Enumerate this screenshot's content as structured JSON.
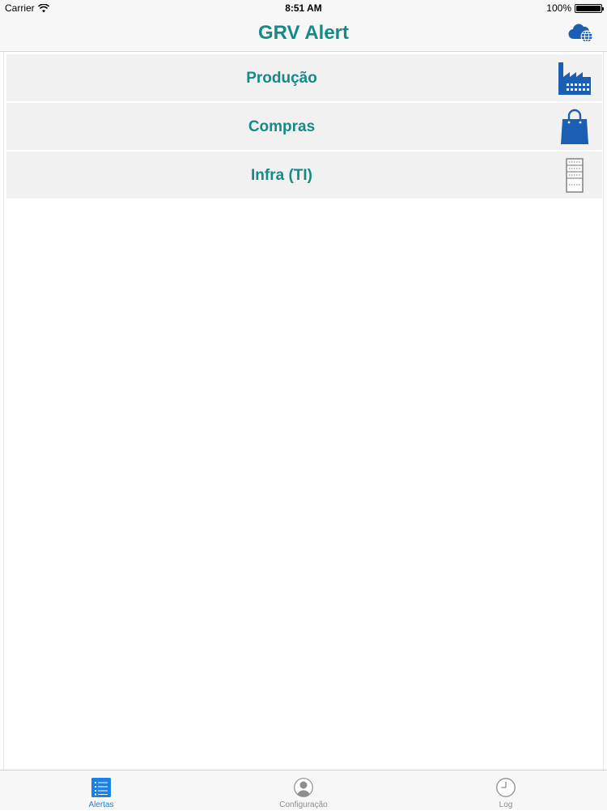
{
  "status_bar": {
    "carrier": "Carrier",
    "time": "8:51 AM",
    "battery": "100%",
    "battery_level": 1.0
  },
  "nav": {
    "title": "GRV Alert",
    "right_icon": "cloud-globe-icon"
  },
  "menu": {
    "items": [
      {
        "label": "Produção",
        "icon": "factory-icon"
      },
      {
        "label": "Compras",
        "icon": "shopping-bag-icon"
      },
      {
        "label": "Infra (TI)",
        "icon": "server-icon"
      }
    ]
  },
  "tabs": {
    "items": [
      {
        "label": "Alertas",
        "icon": "list-icon",
        "active": true
      },
      {
        "label": "Configuração",
        "icon": "user-icon",
        "active": false
      },
      {
        "label": "Log",
        "icon": "clock-icon",
        "active": false
      }
    ]
  },
  "colors": {
    "accent_teal": "#168a86",
    "icon_blue": "#1a5fb4",
    "tab_active": "#1a82e6",
    "tab_inactive": "#8e8e8e"
  }
}
